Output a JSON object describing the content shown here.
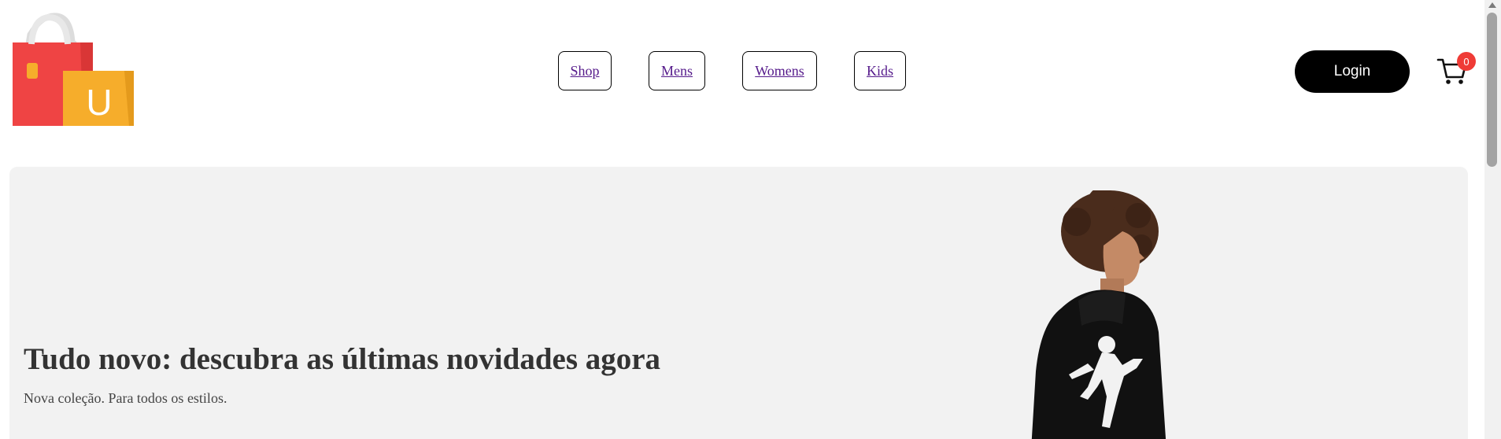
{
  "header": {
    "logo_letter": "U",
    "nav": [
      {
        "label": "Shop"
      },
      {
        "label": "Mens"
      },
      {
        "label": "Womens"
      },
      {
        "label": "Kids"
      }
    ],
    "login_label": "Login",
    "cart_count": "0",
    "cart_icon": "cart-icon"
  },
  "hero": {
    "title": "Tudo novo: descubra as últimas novidades agora",
    "subtitle": "Nova coleção. Para todos os estilos.",
    "image": "child-in-black-hoodie-photo"
  },
  "colors": {
    "bag_red": "#ef4444",
    "bag_yellow": "#f6ad2b",
    "login_bg": "#000000",
    "badge": "#ef3b36",
    "hero_bg": "#f2f2f2",
    "link": "#551a8b"
  }
}
